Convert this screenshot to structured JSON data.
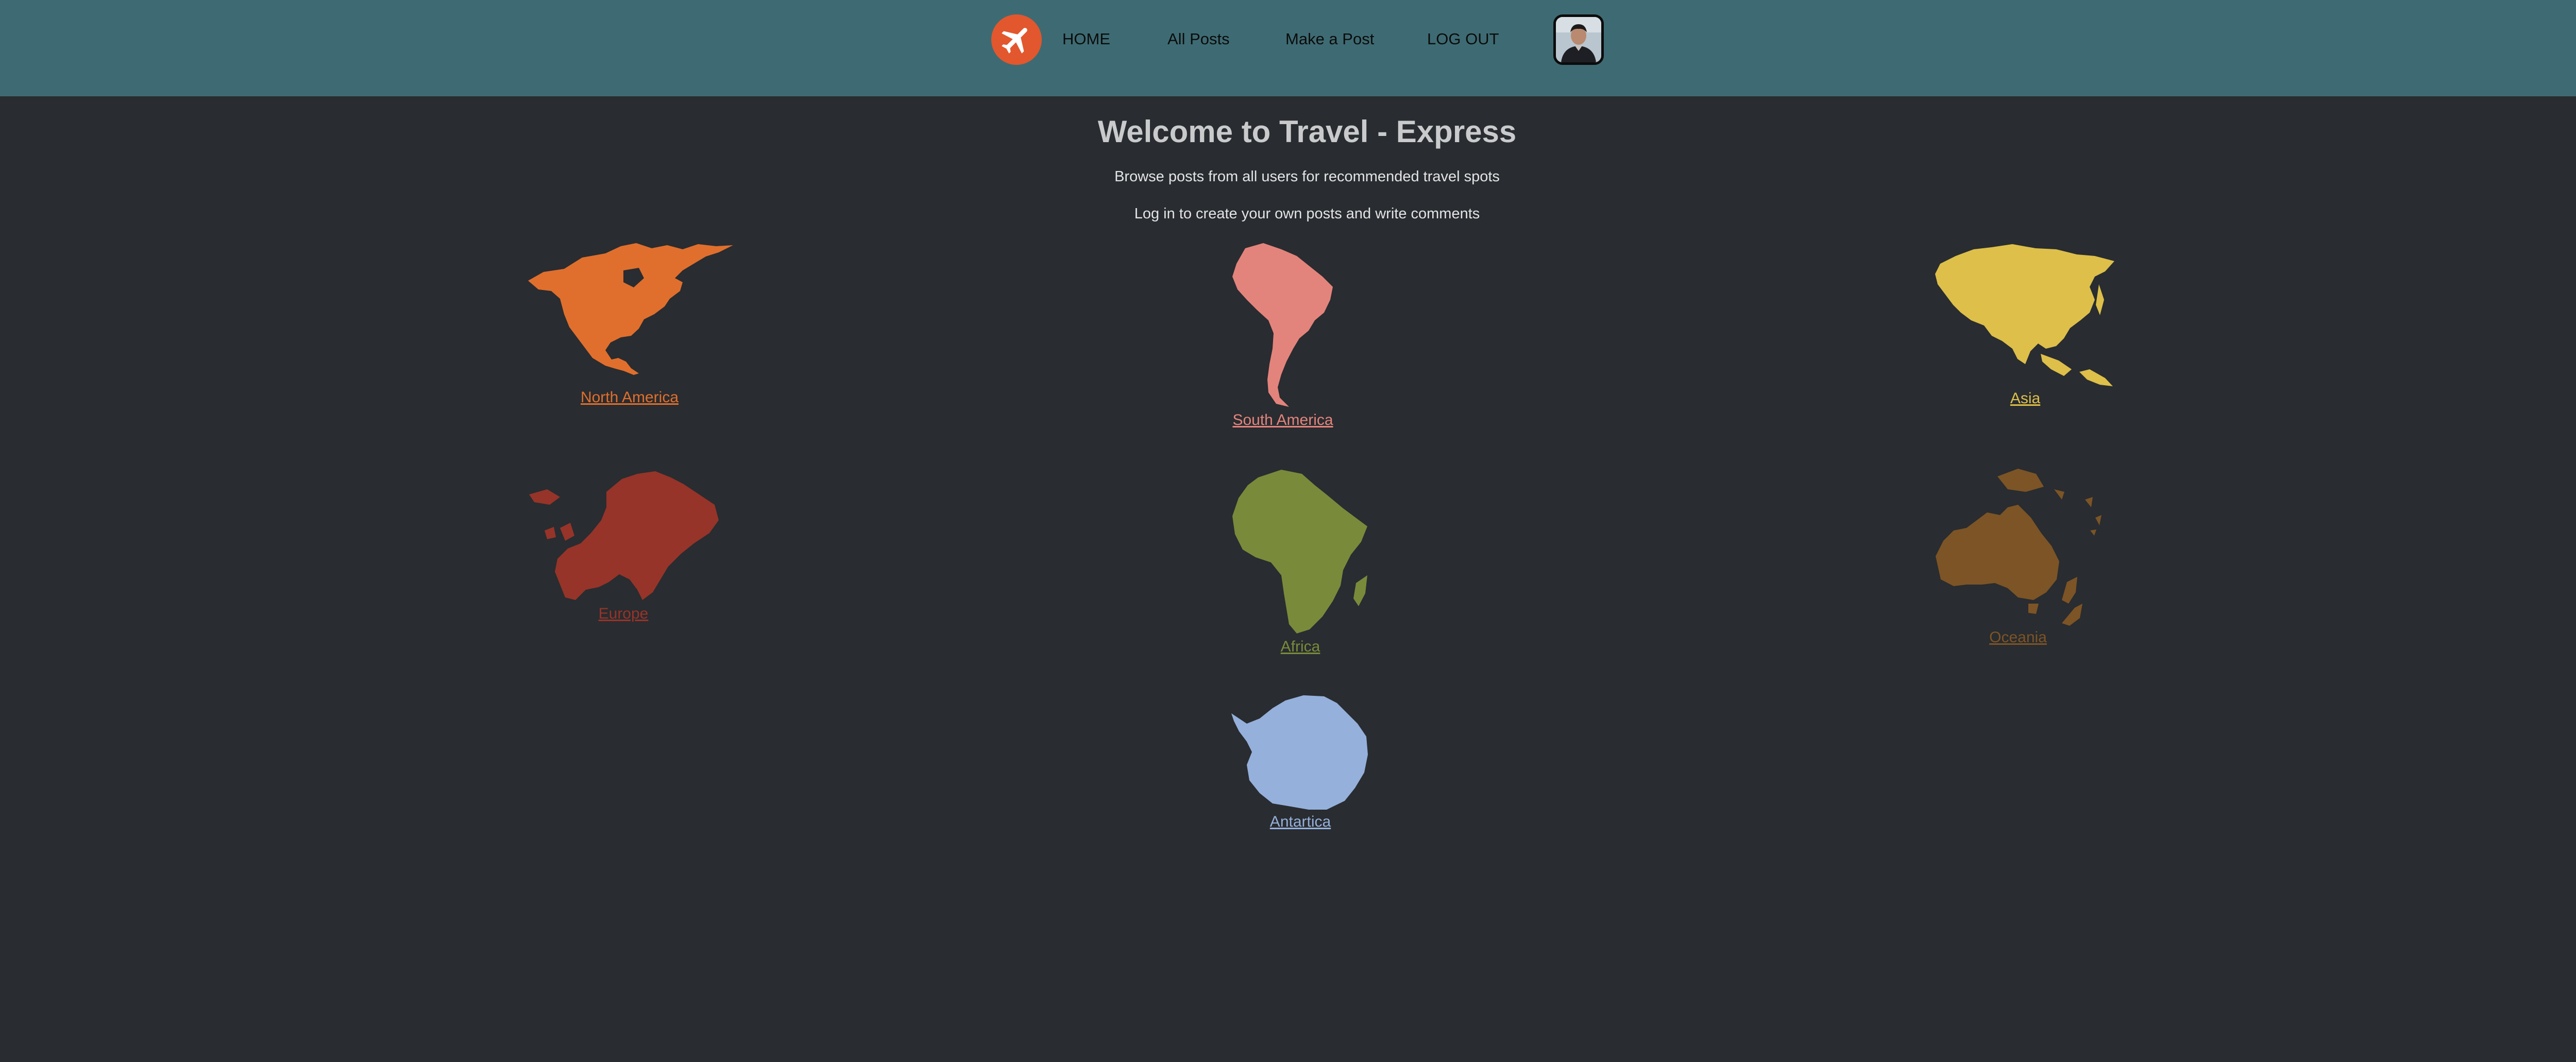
{
  "nav": {
    "links": [
      "HOME",
      "All Posts",
      "Make a Post",
      "LOG OUT"
    ]
  },
  "main": {
    "title": "Welcome to Travel - Express",
    "subtitle_1": "Browse posts from all users for recommended travel spots",
    "subtitle_2": "Log in to create your own posts and write comments"
  },
  "continents": [
    {
      "label": "North America",
      "color": "#e06f2d"
    },
    {
      "label": "South America",
      "color": "#e3847c"
    },
    {
      "label": "Asia",
      "color": "#ddbf4a"
    },
    {
      "label": "Europe",
      "color": "#963429"
    },
    {
      "label": "Africa",
      "color": "#7a8a3b"
    },
    {
      "label": "Oceania",
      "color": "#7c5426"
    },
    {
      "label": "Antartica",
      "color": "#95b0db"
    }
  ]
}
